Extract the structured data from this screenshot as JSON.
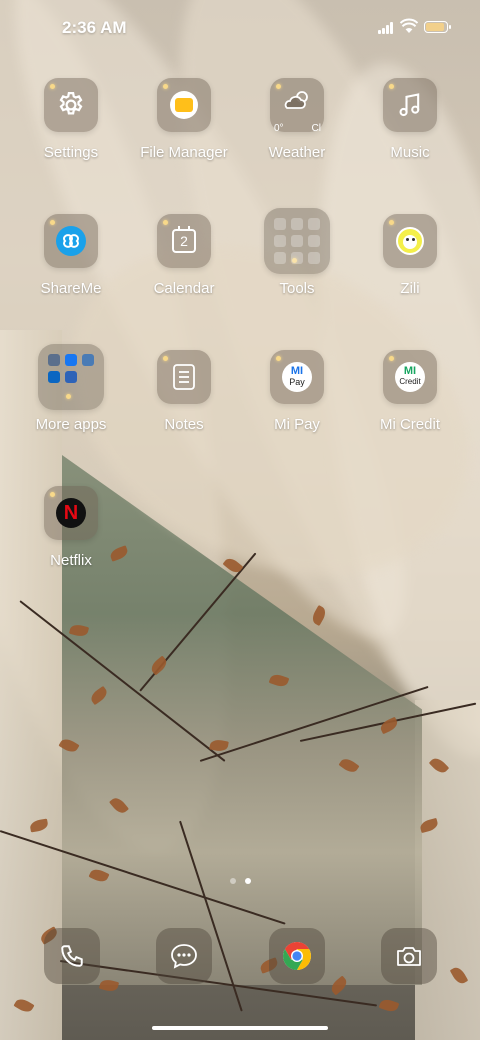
{
  "status_bar": {
    "time": "2:36 AM",
    "battery_level_percent": 100
  },
  "apps": [
    {
      "id": "settings",
      "label": "Settings",
      "icon": "gear-icon"
    },
    {
      "id": "file-manager",
      "label": "File Manager",
      "icon": "folder-icon"
    },
    {
      "id": "weather",
      "label": "Weather",
      "icon": "weather-icon",
      "widget_text_left": "0°",
      "widget_text_right": "Cl"
    },
    {
      "id": "music",
      "label": "Music",
      "icon": "music-note-icon"
    },
    {
      "id": "shareme",
      "label": "ShareMe",
      "icon": "shareme-icon"
    },
    {
      "id": "calendar",
      "label": "Calendar",
      "icon": "calendar-icon",
      "day": "2"
    },
    {
      "id": "tools",
      "label": "Tools",
      "icon": "folder-icon"
    },
    {
      "id": "zili",
      "label": "Zili",
      "icon": "zili-icon"
    },
    {
      "id": "more-apps",
      "label": "More apps",
      "icon": "folder-icon"
    },
    {
      "id": "notes",
      "label": "Notes",
      "icon": "notes-icon"
    },
    {
      "id": "mi-pay",
      "label": "Mi Pay",
      "icon": "mi-pay-icon",
      "badge_text": "Pay"
    },
    {
      "id": "mi-credit",
      "label": "Mi Credit",
      "icon": "mi-credit-icon",
      "badge_text": "Credit"
    },
    {
      "id": "netflix",
      "label": "Netflix",
      "icon": "netflix-icon",
      "logo_letter": "N"
    }
  ],
  "mi_logo": "MI",
  "dock": [
    {
      "id": "phone",
      "icon": "phone-icon"
    },
    {
      "id": "messaging",
      "icon": "message-icon"
    },
    {
      "id": "chrome",
      "icon": "chrome-icon"
    },
    {
      "id": "camera",
      "icon": "camera-icon"
    }
  ],
  "pager": {
    "pages": 2,
    "current": 2
  },
  "colors": {
    "accent_dot": "#f8d98a",
    "shareme_blue": "#1aa1ea",
    "file_yellow": "#ffbf1a",
    "netflix_red": "#e50914"
  }
}
